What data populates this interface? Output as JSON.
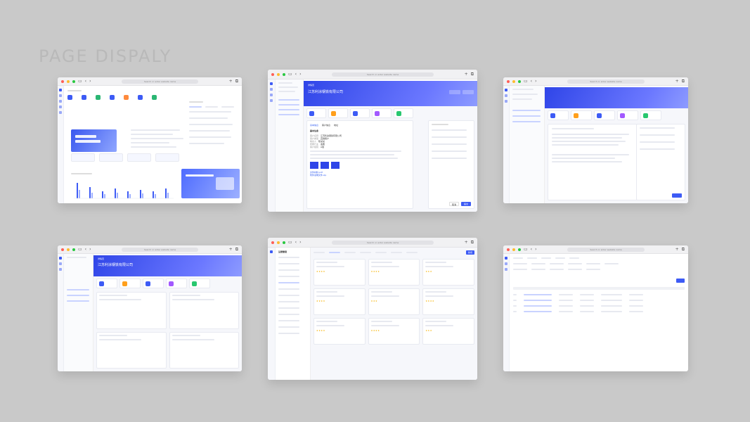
{
  "page_title": "PAGE DISPALY",
  "browser": {
    "url": "Search or enter website name"
  },
  "colors": {
    "accent": "#3d5bf5",
    "background": "#c9c9c9"
  },
  "icons": [
    "sidebar-icon",
    "back-icon",
    "forward-icon",
    "plus-icon",
    "tabs-icon"
  ],
  "w2": {
    "company": "江苏利涂钢铁有限公司",
    "detail_title": "详情页",
    "sections": [
      "基本信息",
      "客户信息",
      "地址",
      "附件"
    ],
    "fields": [
      {
        "label": "客户名称",
        "value": "江苏利涂钢铁有限公司"
      },
      {
        "label": "客户类型",
        "value": "直销客户"
      },
      {
        "label": "联系人",
        "value": "陈某某"
      },
      {
        "label": "所属行业",
        "value": "金属"
      },
      {
        "label": "客户级别",
        "value": "A级"
      }
    ],
    "files": [
      "文件材料.pdf",
      "附件说明文件.zip"
    ],
    "submit": "提交",
    "cancel": "取消"
  },
  "w4": {
    "company": "江苏利涂钢铁有限公司",
    "detail_title": "详情页"
  },
  "w5": {
    "title": "运营管理",
    "btn": "新增"
  }
}
